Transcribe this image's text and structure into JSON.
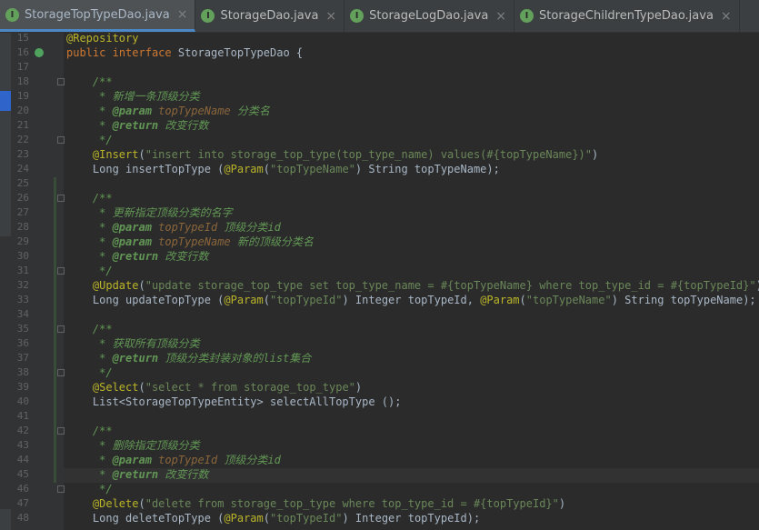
{
  "tabs": [
    {
      "label": "StorageTopTypeDao.java",
      "active": true
    },
    {
      "label": "StorageDao.java",
      "active": false
    },
    {
      "label": "StorageLogDao.java",
      "active": false
    },
    {
      "label": "StorageChildrenTypeDao.java",
      "active": false
    }
  ],
  "tab_icon_letter": "I",
  "tab_close": "×",
  "colors": {
    "keyword": "#cc7832",
    "string": "#6a8759",
    "annotation": "#bbb529",
    "comment": "#629755",
    "param": "#8a653b",
    "text": "#a9b7c6"
  },
  "lines": [
    {
      "n": "15",
      "t": "@Repository"
    },
    {
      "n": "16",
      "t": "public interface StorageTopTypeDao {"
    },
    {
      "n": "17",
      "t": ""
    },
    {
      "n": "18",
      "t": "    /**"
    },
    {
      "n": "19",
      "t": "     * 新增一条顶级分类"
    },
    {
      "n": "20",
      "t": "     * @param topTypeName 分类名"
    },
    {
      "n": "21",
      "t": "     * @return 改变行数"
    },
    {
      "n": "22",
      "t": "     */"
    },
    {
      "n": "23",
      "t": "    @Insert(\"insert into storage_top_type(top_type_name) values(#{topTypeName})\")"
    },
    {
      "n": "24",
      "t": "    Long insertTopType (@Param(\"topTypeName\") String topTypeName);"
    },
    {
      "n": "25",
      "t": ""
    },
    {
      "n": "26",
      "t": "    /**"
    },
    {
      "n": "27",
      "t": "     * 更新指定顶级分类的名字"
    },
    {
      "n": "28",
      "t": "     * @param topTypeId 顶级分类id"
    },
    {
      "n": "29",
      "t": "     * @param topTypeName 新的顶级分类名"
    },
    {
      "n": "30",
      "t": "     * @return 改变行数"
    },
    {
      "n": "31",
      "t": "     */"
    },
    {
      "n": "32",
      "t": "    @Update(\"update storage_top_type set top_type_name = #{topTypeName} where top_type_id = #{topTypeId}\")"
    },
    {
      "n": "33",
      "t": "    Long updateTopType (@Param(\"topTypeId\") Integer topTypeId, @Param(\"topTypeName\") String topTypeName);"
    },
    {
      "n": "34",
      "t": ""
    },
    {
      "n": "35",
      "t": "    /**"
    },
    {
      "n": "36",
      "t": "     * 获取所有顶级分类"
    },
    {
      "n": "37",
      "t": "     * @return 顶级分类封装对象的list集合"
    },
    {
      "n": "38",
      "t": "     */"
    },
    {
      "n": "39",
      "t": "    @Select(\"select * from storage_top_type\")"
    },
    {
      "n": "40",
      "t": "    List<StorageTopTypeEntity> selectAllTopType ();"
    },
    {
      "n": "41",
      "t": ""
    },
    {
      "n": "42",
      "t": "    /**"
    },
    {
      "n": "43",
      "t": "     * 删除指定顶级分类"
    },
    {
      "n": "44",
      "t": "     * @param topTypeId 顶级分类id"
    },
    {
      "n": "45",
      "t": "     * @return 改变行数"
    },
    {
      "n": "46",
      "t": "     */"
    },
    {
      "n": "47",
      "t": "    @Delete(\"delete from storage_top_type where top_type_id = #{topTypeId}\")"
    },
    {
      "n": "48",
      "t": "    Long deleteTopType (@Param(\"topTypeId\") Integer topTypeId);"
    }
  ]
}
